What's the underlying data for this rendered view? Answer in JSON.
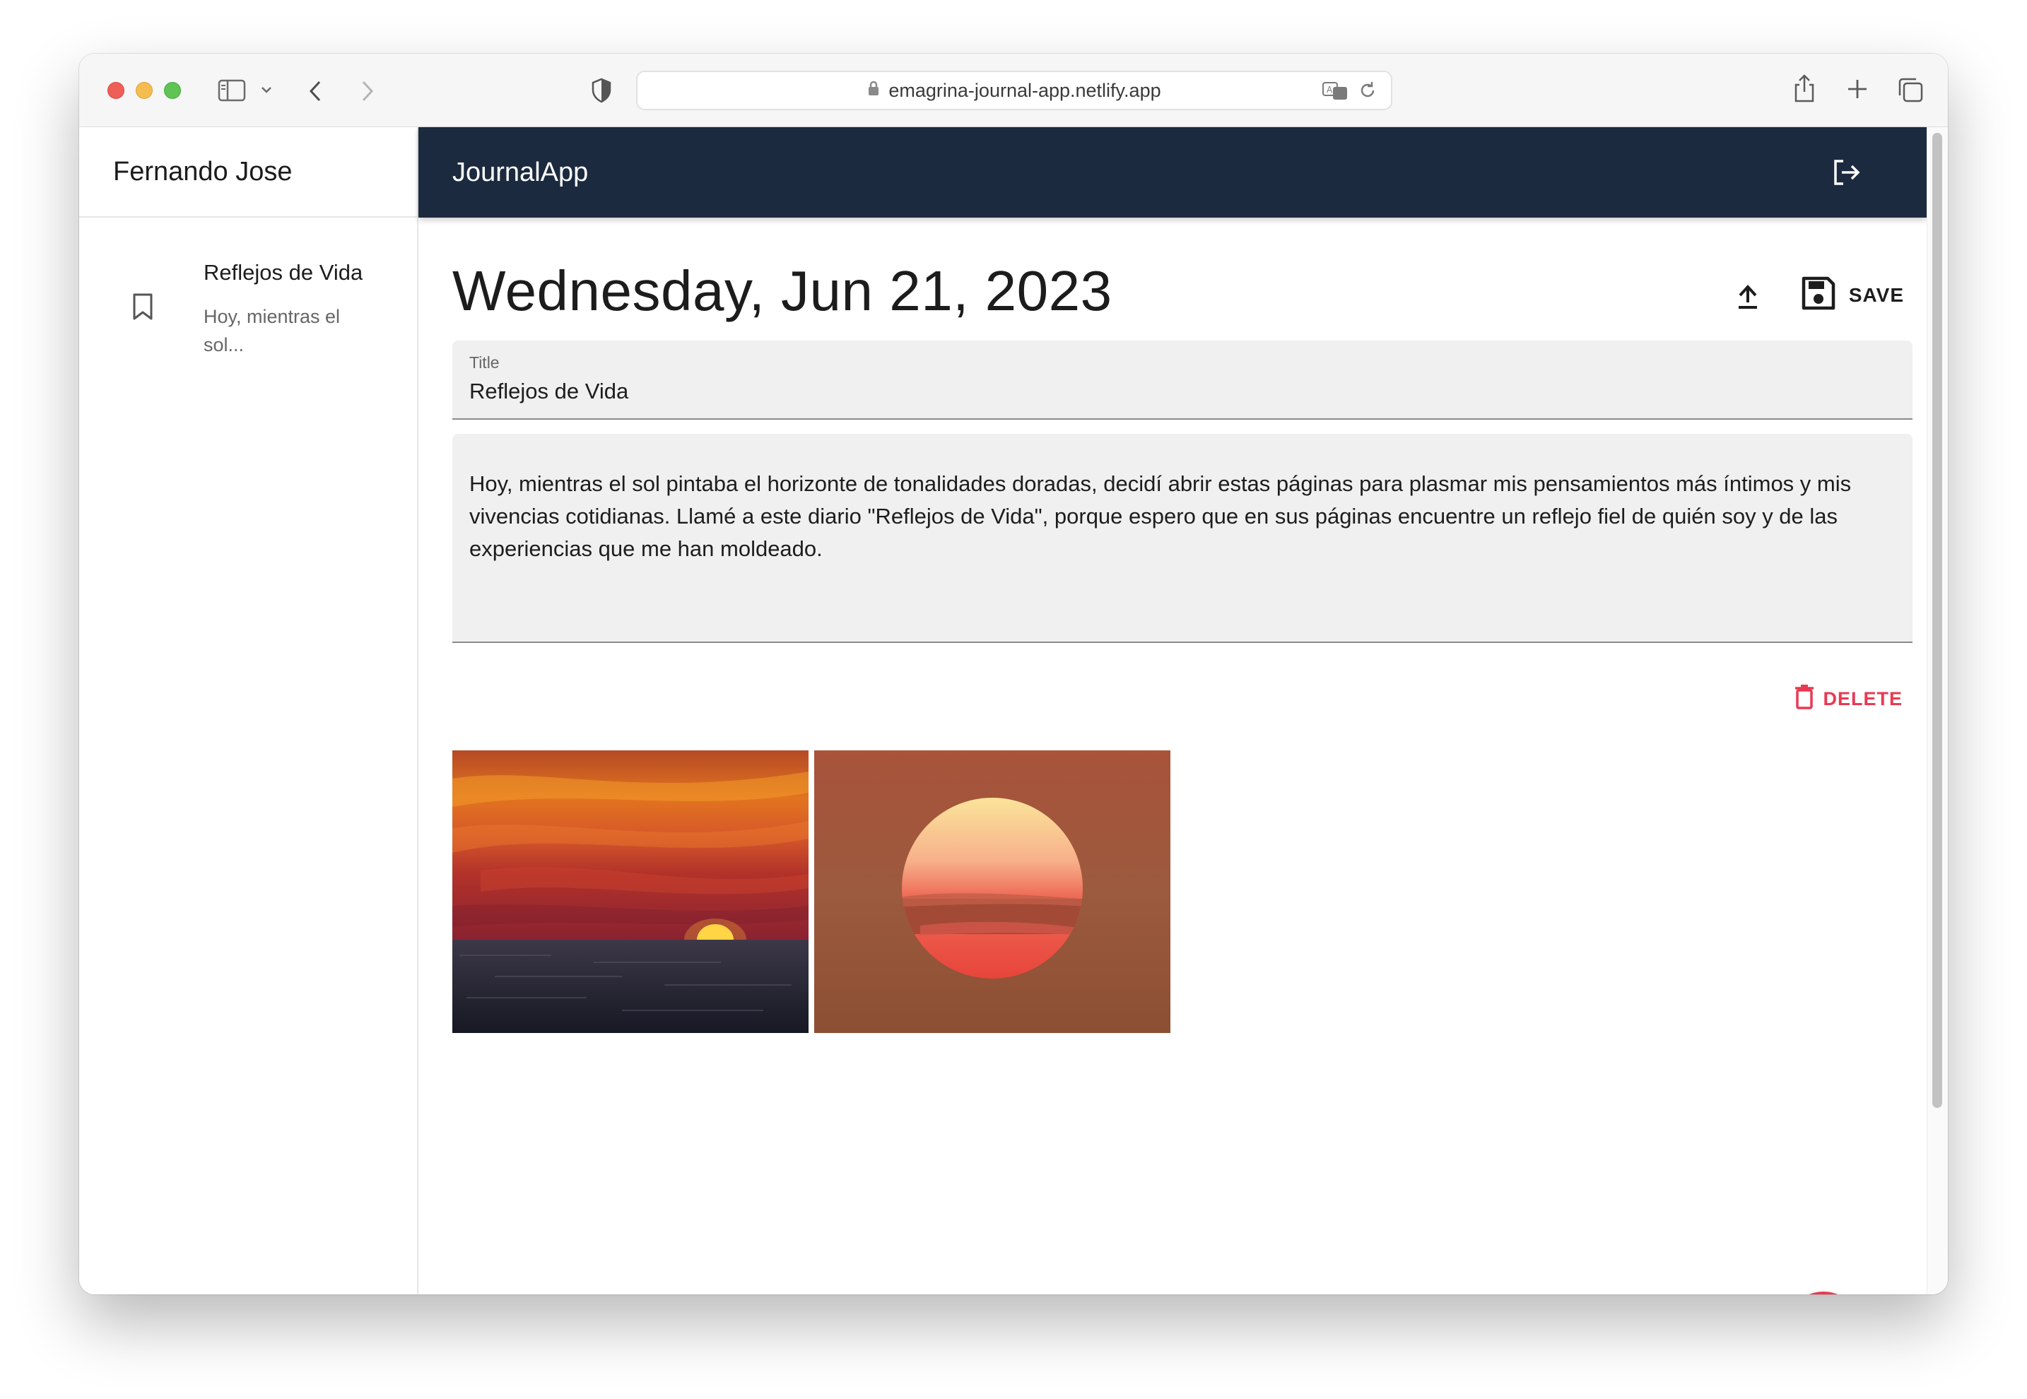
{
  "browser": {
    "url": "emagrina-journal-app.netlify.app"
  },
  "sidebar": {
    "user_name": "Fernando Jose",
    "entries": [
      {
        "title": "Reflejos de Vida",
        "snippet": "Hoy, mientras el sol..."
      }
    ]
  },
  "topbar": {
    "brand": "JournalApp"
  },
  "note": {
    "date": "Wednesday, Jun 21, 2023",
    "save_label": "SAVE",
    "title_label": "Title",
    "title_value": "Reflejos de Vida",
    "body": "Hoy, mientras el sol pintaba el horizonte de tonalidades doradas, decidí abrir estas páginas para plasmar mis pensamientos más íntimos y mis vivencias cotidianas. Llamé a este diario \"Reflejos de Vida\", porque espero que en sus páginas encuentre un reflejo fiel de quién soy y de las experiencias que me han moldeado.",
    "delete_label": "DELETE",
    "images": [
      {
        "icon": "sunset-over-sea-image"
      },
      {
        "icon": "red-sun-image"
      }
    ]
  },
  "colors": {
    "topbar_bg": "#1c2a3f",
    "accent": "#e83a52"
  }
}
